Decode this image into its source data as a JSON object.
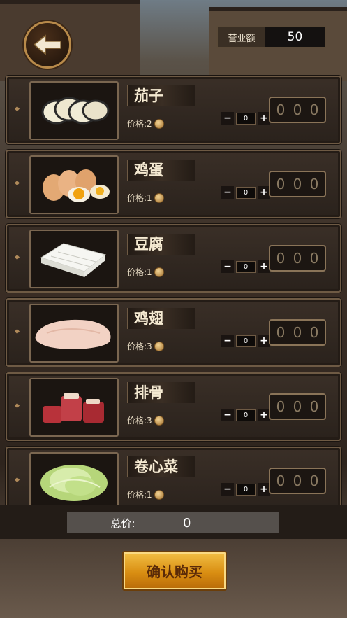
{
  "header": {
    "back_icon": "arrow-left-icon",
    "revenue_label": "营业额",
    "revenue_value": "50"
  },
  "items": [
    {
      "name": "茄子",
      "price_label": "价格:",
      "price": "2",
      "qty": "0",
      "digits": [
        "0",
        "0",
        "0"
      ],
      "image": "eggplant"
    },
    {
      "name": "鸡蛋",
      "price_label": "价格:",
      "price": "1",
      "qty": "0",
      "digits": [
        "0",
        "0",
        "0"
      ],
      "image": "eggs"
    },
    {
      "name": "豆腐",
      "price_label": "价格:",
      "price": "1",
      "qty": "0",
      "digits": [
        "0",
        "0",
        "0"
      ],
      "image": "tofu"
    },
    {
      "name": "鸡翅",
      "price_label": "价格:",
      "price": "3",
      "qty": "0",
      "digits": [
        "0",
        "0",
        "0"
      ],
      "image": "chicken-wing"
    },
    {
      "name": "排骨",
      "price_label": "价格:",
      "price": "3",
      "qty": "0",
      "digits": [
        "0",
        "0",
        "0"
      ],
      "image": "spare-ribs"
    },
    {
      "name": "卷心菜",
      "price_label": "价格:",
      "price": "1",
      "qty": "0",
      "digits": [
        "0",
        "0",
        "0"
      ],
      "image": "cabbage"
    }
  ],
  "stepper": {
    "minus": "−",
    "plus": "+"
  },
  "total": {
    "label": "总价:",
    "value": "0"
  },
  "confirm_label": "确认购买"
}
